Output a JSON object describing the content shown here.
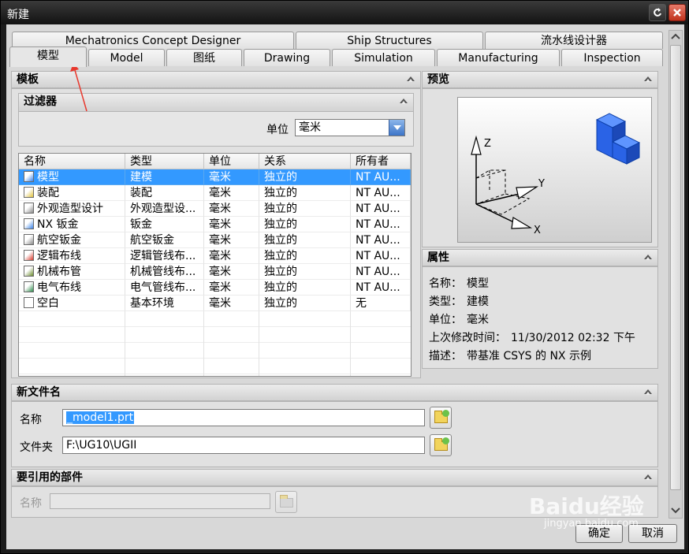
{
  "window": {
    "title": "新建"
  },
  "tabs_row1": [
    "Mechatronics Concept Designer",
    "Ship Structures",
    "流水线设计器"
  ],
  "tabs_row2": [
    "模型",
    "Model",
    "图纸",
    "Drawing",
    "Simulation",
    "Manufacturing",
    "Inspection"
  ],
  "templates": {
    "header": "模板",
    "filter": {
      "header": "过滤器",
      "unit_label": "单位",
      "unit_value": "毫米"
    },
    "columns": [
      "名称",
      "类型",
      "单位",
      "关系",
      "所有者"
    ],
    "rows": [
      {
        "name": "模型",
        "type": "建模",
        "unit": "毫米",
        "relation": "独立的",
        "owner": "NT AU...",
        "icon": "model-icon",
        "selected": true
      },
      {
        "name": "装配",
        "type": "装配",
        "unit": "毫米",
        "relation": "独立的",
        "owner": "NT AU...",
        "icon": "assembly-icon"
      },
      {
        "name": "外观造型设计",
        "type": "外观造型设...",
        "unit": "毫米",
        "relation": "独立的",
        "owner": "NT AU...",
        "icon": "shape-design-icon"
      },
      {
        "name": "NX 钣金",
        "type": "钣金",
        "unit": "毫米",
        "relation": "独立的",
        "owner": "NT AU...",
        "icon": "sheet-metal-icon"
      },
      {
        "name": "航空钣金",
        "type": "航空钣金",
        "unit": "毫米",
        "relation": "独立的",
        "owner": "NT AU...",
        "icon": "aero-sheet-metal-icon"
      },
      {
        "name": "逻辑布线",
        "type": "逻辑管线布...",
        "unit": "毫米",
        "relation": "独立的",
        "owner": "NT AU...",
        "icon": "logical-routing-icon"
      },
      {
        "name": "机械布管",
        "type": "机械管线布...",
        "unit": "毫米",
        "relation": "独立的",
        "owner": "NT AU...",
        "icon": "mechanical-routing-icon"
      },
      {
        "name": "电气布线",
        "type": "电气管线布...",
        "unit": "毫米",
        "relation": "独立的",
        "owner": "NT AU...",
        "icon": "electrical-routing-icon"
      },
      {
        "name": "空白",
        "type": "基本环境",
        "unit": "毫米",
        "relation": "独立的",
        "owner": "无",
        "icon": "blank-icon"
      }
    ]
  },
  "preview": {
    "header": "预览",
    "axis_z": "Z",
    "axis_y": "Y",
    "axis_x": "X"
  },
  "properties": {
    "header": "属性",
    "items": [
      {
        "label": "名称：",
        "value": "模型"
      },
      {
        "label": "类型：",
        "value": "建模"
      },
      {
        "label": "单位：",
        "value": "毫米"
      },
      {
        "label": "上次修改时间：",
        "value": "11/30/2012 02:32 下午"
      },
      {
        "label": "描述：",
        "value": "带基准 CSYS 的 NX 示例"
      }
    ]
  },
  "new_file": {
    "header": "新文件名",
    "name_label": "名称",
    "name_value": "_model1.prt",
    "folder_label": "文件夹",
    "folder_value": "F:\\UG10\\UGII"
  },
  "referenced_parts": {
    "header": "要引用的部件",
    "name_label": "名称",
    "name_value": ""
  },
  "buttons": {
    "ok": "确定",
    "cancel": "取消"
  },
  "watermark": {
    "text": "Baidu经验",
    "url": "jingyan.baidu.com"
  },
  "colors": {
    "selection": "#3399ff",
    "arrow": "#e8372c",
    "cube": "#1f5fe0"
  }
}
